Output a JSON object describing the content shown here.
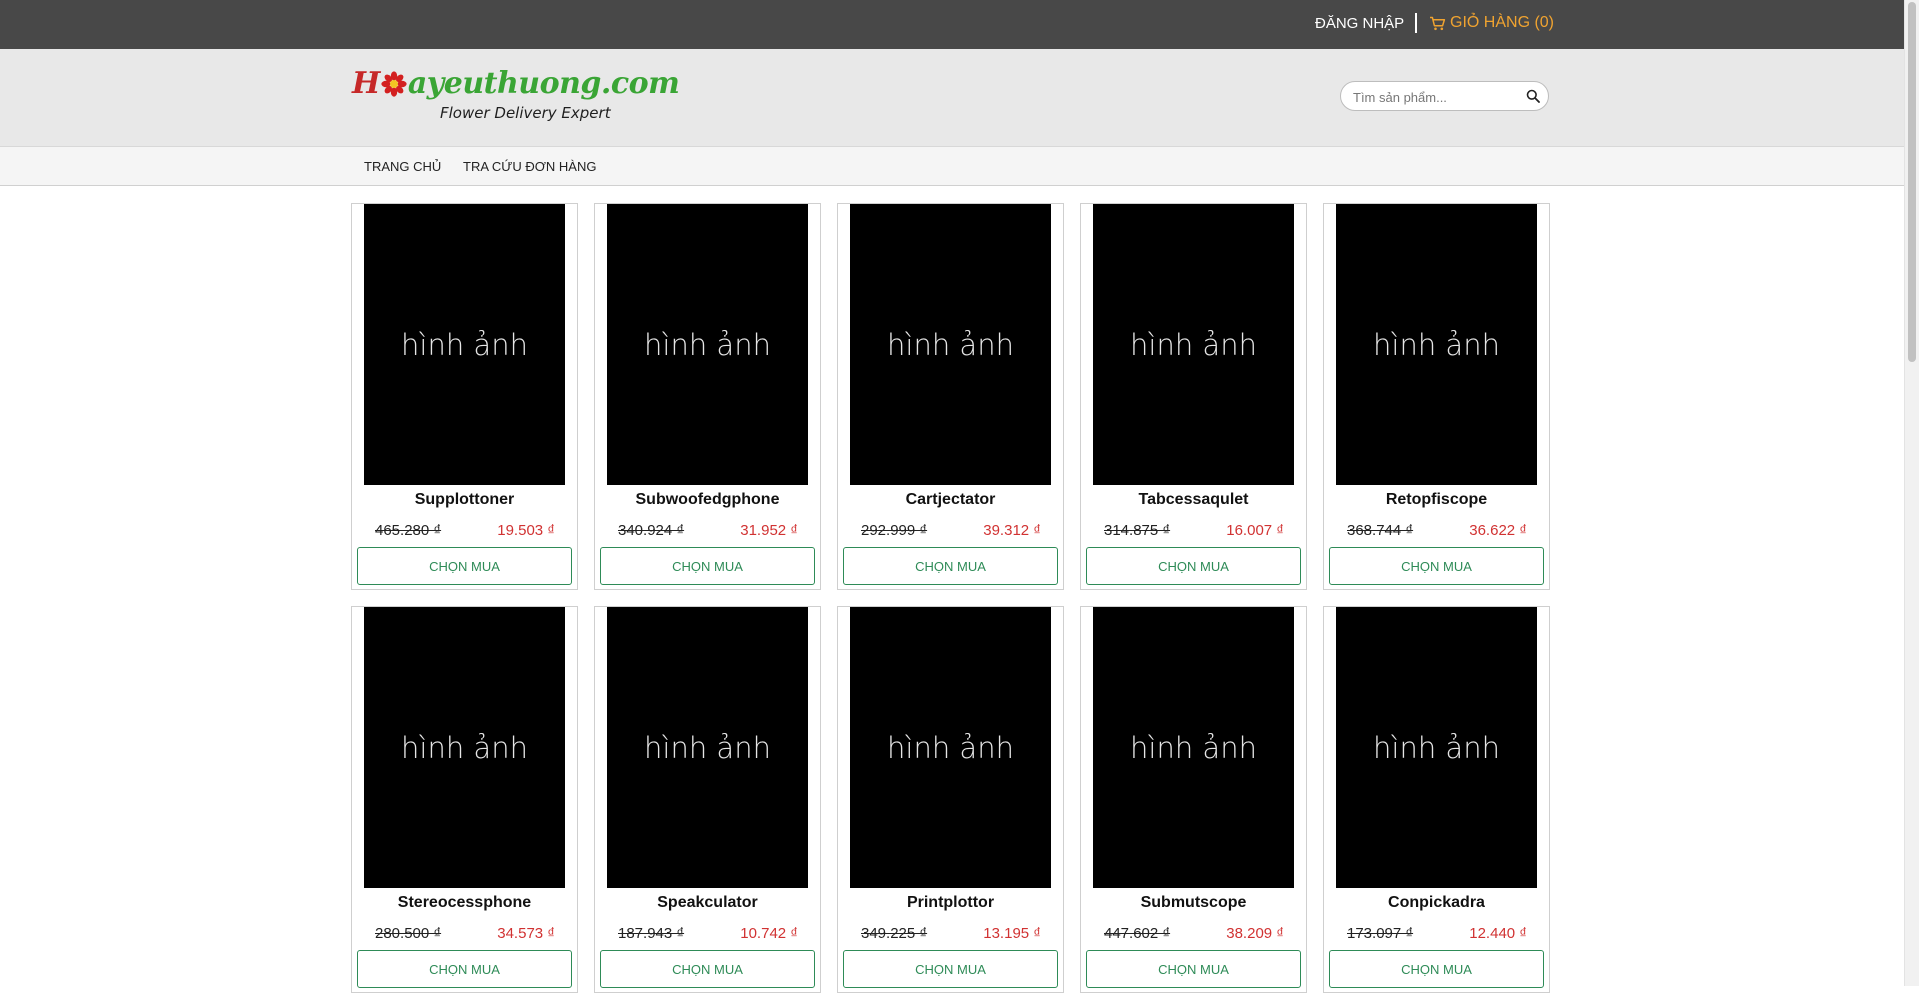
{
  "topbar": {
    "login_label": "ĐĂNG NHẬP",
    "cart_label": "GIỎ HÀNG (0)",
    "cart_icon": "shopping-cart-icon"
  },
  "logo": {
    "prefix": "H",
    "suffix": "ayeuthuong.com",
    "tagline": "Flower Delivery Expert"
  },
  "search": {
    "placeholder": "Tìm sản phẩm...",
    "icon": "search-icon"
  },
  "nav": {
    "items": [
      "TRANG CHỦ",
      "TRA CỨU ĐƠN HÀNG"
    ]
  },
  "products": [
    {
      "image_text": "hình ảnh",
      "name": "Supplottoner",
      "old_price": "465.280 ₫",
      "price": "19.503 ₫",
      "buy_label": "CHỌN MUA"
    },
    {
      "image_text": "hình ảnh",
      "name": "Subwoofedgphone",
      "old_price": "340.924 ₫",
      "price": "31.952 ₫",
      "buy_label": "CHỌN MUA"
    },
    {
      "image_text": "hình ảnh",
      "name": "Cartjectator",
      "old_price": "292.999 ₫",
      "price": "39.312 ₫",
      "buy_label": "CHỌN MUA"
    },
    {
      "image_text": "hình ảnh",
      "name": "Tabcessaqulet",
      "old_price": "314.875 ₫",
      "price": "16.007 ₫",
      "buy_label": "CHỌN MUA"
    },
    {
      "image_text": "hình ảnh",
      "name": "Retopfiscope",
      "old_price": "368.744 ₫",
      "price": "36.622 ₫",
      "buy_label": "CHỌN MUA"
    },
    {
      "image_text": "hình ảnh",
      "name": "Stereocessphone",
      "old_price": "280.500 ₫",
      "price": "34.573 ₫",
      "buy_label": "CHỌN MUA"
    },
    {
      "image_text": "hình ảnh",
      "name": "Speakculator",
      "old_price": "187.943 ₫",
      "price": "10.742 ₫",
      "buy_label": "CHỌN MUA"
    },
    {
      "image_text": "hình ảnh",
      "name": "Printplottor",
      "old_price": "349.225 ₫",
      "price": "13.195 ₫",
      "buy_label": "CHỌN MUA"
    },
    {
      "image_text": "hình ảnh",
      "name": "Submutscope",
      "old_price": "447.602 ₫",
      "price": "38.209 ₫",
      "buy_label": "CHỌN MUA"
    },
    {
      "image_text": "hình ảnh",
      "name": "Conpickadra",
      "old_price": "173.097 ₫",
      "price": "12.440 ₫",
      "buy_label": "CHỌN MUA"
    }
  ],
  "colors": {
    "topbar_bg": "#484848",
    "cart_accent": "#f0a330",
    "header_bg": "#e8e8e8",
    "price_red": "#d13232",
    "button_green": "#2e8b57"
  }
}
